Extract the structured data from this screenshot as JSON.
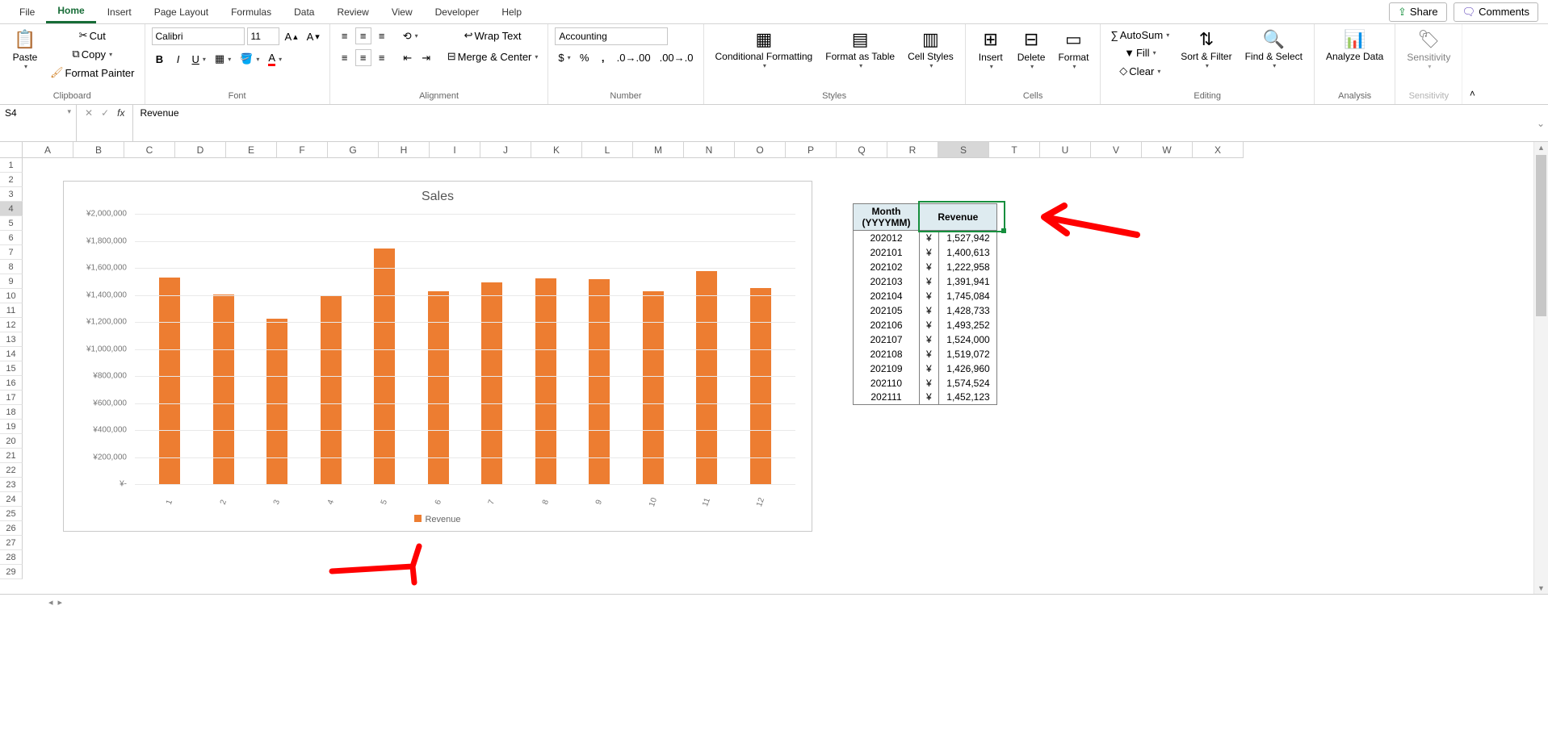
{
  "tabs": [
    "File",
    "Home",
    "Insert",
    "Page Layout",
    "Formulas",
    "Data",
    "Review",
    "View",
    "Developer",
    "Help"
  ],
  "activeTab": "Home",
  "share": "Share",
  "comments": "Comments",
  "ribbon": {
    "clipboard": {
      "paste": "Paste",
      "cut": "Cut",
      "copy": "Copy",
      "fmtpainter": "Format Painter",
      "label": "Clipboard"
    },
    "font": {
      "name": "Calibri",
      "size": "11",
      "label": "Font"
    },
    "alignment": {
      "wrap": "Wrap Text",
      "merge": "Merge & Center",
      "label": "Alignment"
    },
    "number": {
      "format": "Accounting",
      "label": "Number"
    },
    "styles": {
      "cond": "Conditional Formatting",
      "fat": "Format as Table",
      "cell": "Cell Styles",
      "label": "Styles"
    },
    "cells": {
      "ins": "Insert",
      "del": "Delete",
      "fmt": "Format",
      "label": "Cells"
    },
    "editing": {
      "sum": "AutoSum",
      "fill": "Fill",
      "clear": "Clear",
      "sort": "Sort & Filter",
      "find": "Find & Select",
      "label": "Editing"
    },
    "analysis": {
      "btn": "Analyze Data",
      "label": "Analysis"
    },
    "sens": {
      "btn": "Sensitivity",
      "label": "Sensitivity"
    }
  },
  "nameBox": "S4",
  "formula": "Revenue",
  "columns": [
    "A",
    "B",
    "C",
    "D",
    "E",
    "F",
    "G",
    "H",
    "I",
    "J",
    "K",
    "L",
    "M",
    "N",
    "O",
    "P",
    "Q",
    "R",
    "S",
    "T",
    "U",
    "V",
    "W",
    "X"
  ],
  "selectedCol": "S",
  "rows_count": 29,
  "selectedRow": 4,
  "chart_data": {
    "type": "bar",
    "title": "Sales",
    "series_name": "Revenue",
    "categories": [
      "1",
      "2",
      "3",
      "4",
      "5",
      "6",
      "7",
      "8",
      "9",
      "10",
      "11",
      "12"
    ],
    "values": [
      1527942,
      1400613,
      1222958,
      1391941,
      1745084,
      1428733,
      1493252,
      1524000,
      1519072,
      1426960,
      1574524,
      1452123
    ],
    "y_ticks": [
      "¥-",
      "¥200,000",
      "¥400,000",
      "¥600,000",
      "¥800,000",
      "¥1,000,000",
      "¥1,200,000",
      "¥1,400,000",
      "¥1,600,000",
      "¥1,800,000",
      "¥2,000,000"
    ],
    "ymax": 2000000
  },
  "table": {
    "h1": "Month (YYYYMM)",
    "h2": "Revenue",
    "currency": "¥",
    "rows": [
      {
        "m": "202012",
        "v": "1,527,942"
      },
      {
        "m": "202101",
        "v": "1,400,613"
      },
      {
        "m": "202102",
        "v": "1,222,958"
      },
      {
        "m": "202103",
        "v": "1,391,941"
      },
      {
        "m": "202104",
        "v": "1,745,084"
      },
      {
        "m": "202105",
        "v": "1,428,733"
      },
      {
        "m": "202106",
        "v": "1,493,252"
      },
      {
        "m": "202107",
        "v": "1,524,000"
      },
      {
        "m": "202108",
        "v": "1,519,072"
      },
      {
        "m": "202109",
        "v": "1,426,960"
      },
      {
        "m": "202110",
        "v": "1,574,524"
      },
      {
        "m": "202111",
        "v": "1,452,123"
      }
    ]
  }
}
